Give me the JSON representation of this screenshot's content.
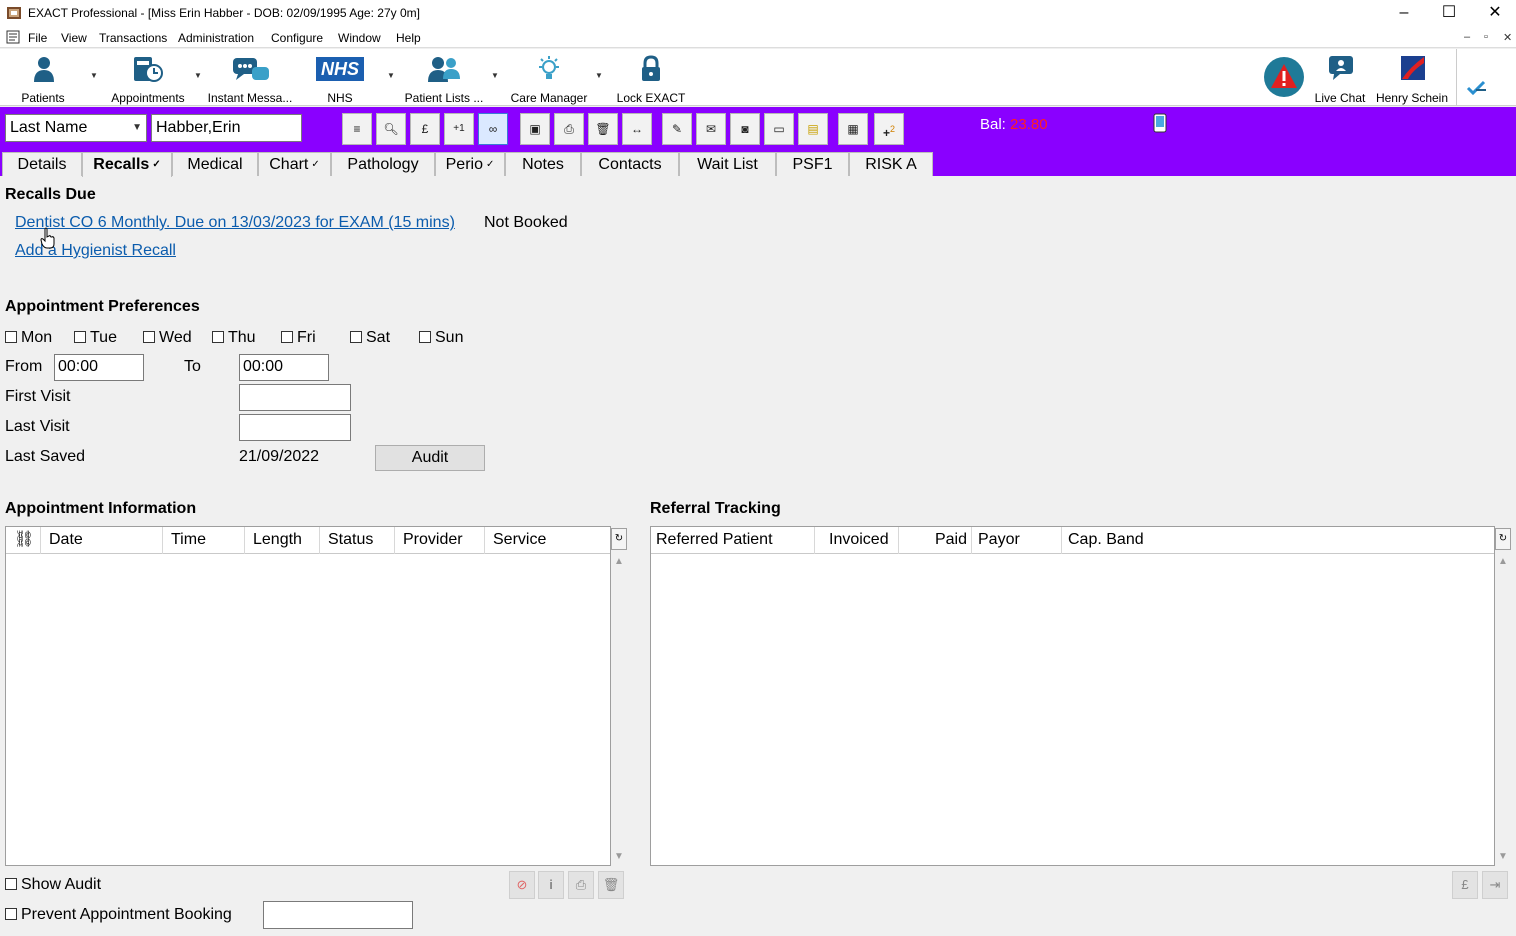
{
  "window": {
    "title": "EXACT Professional - [Miss Erin Habber - DOB: 02/09/1995 Age: 27y 0m]",
    "controls": [
      "–",
      "☐",
      "✕"
    ]
  },
  "menu": {
    "items": [
      "File",
      "View",
      "Transactions",
      "Administration",
      "Configure",
      "Window",
      "Help"
    ],
    "mdi_controls": [
      "–",
      "▫",
      "✕"
    ]
  },
  "toolbar": {
    "patients": "Patients",
    "appointments": "Appointments",
    "instant_messages": "Instant Messa...",
    "nhs": "NHS",
    "nhs_logo": "NHS",
    "patient_lists": "Patient Lists ...",
    "care_manager": "Care Manager",
    "lock": "Lock EXACT",
    "live_chat": "Live Chat",
    "henry_schein": "Henry Schein"
  },
  "patient_bar": {
    "search_field": "Last Name",
    "patient_name": "Habber,Erin",
    "balance_label": "Bal:",
    "balance_value": "23.80",
    "balance_color": "#ff2020"
  },
  "tabs": [
    {
      "label": "Details",
      "check": ""
    },
    {
      "label": "Recalls",
      "check": "✓"
    },
    {
      "label": "Medical",
      "check": ""
    },
    {
      "label": "Chart",
      "check": "✓"
    },
    {
      "label": "Pathology",
      "check": ""
    },
    {
      "label": "Perio",
      "check": "✓"
    },
    {
      "label": "Notes",
      "check": ""
    },
    {
      "label": "Contacts",
      "check": ""
    },
    {
      "label": "Wait List",
      "check": ""
    },
    {
      "label": "PSF1",
      "check": ""
    },
    {
      "label": "RISK A",
      "check": ""
    }
  ],
  "recalls": {
    "title": "Recalls Due",
    "recall_link": "Dentist CO 6 Monthly. Due on 13/03/2023 for EXAM (15 mins)",
    "recall_status": "Not Booked",
    "add_hygienist": "Add a Hygienist Recall"
  },
  "preferences": {
    "title": "Appointment Preferences",
    "days": [
      "Mon",
      "Tue",
      "Wed",
      "Thu",
      "Fri",
      "Sat",
      "Sun"
    ],
    "from_label": "From",
    "from_value": "00:00",
    "to_label": "To",
    "to_value": "00:00",
    "first_visit_label": "First Visit",
    "first_visit_value": "",
    "last_visit_label": "Last Visit",
    "last_visit_value": "",
    "last_saved_label": "Last Saved",
    "last_saved_value": "21/09/2022",
    "audit_button": "Audit"
  },
  "appointment_info": {
    "title": "Appointment Information",
    "columns": [
      "Date",
      "Time",
      "Length",
      "Status",
      "Provider",
      "Service"
    ]
  },
  "referral_tracking": {
    "title": "Referral Tracking",
    "columns": [
      "Referred Patient",
      "Invoiced",
      "Paid",
      "Payor",
      "Cap. Band"
    ]
  },
  "footer": {
    "show_audit": "Show Audit",
    "prevent_booking": "Prevent Appointment Booking",
    "prevent_booking_value": ""
  }
}
